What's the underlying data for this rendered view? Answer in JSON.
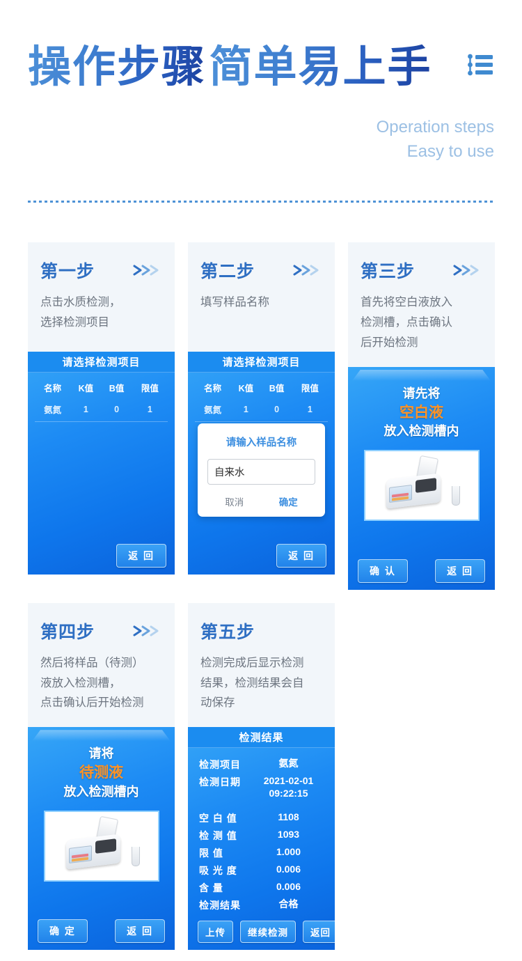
{
  "header": {
    "title_line1": "操作步骤",
    "title_line2": "简单易上手",
    "en_line1": "Operation steps",
    "en_line2": "Easy to use",
    "icon": "list-icon"
  },
  "colors": {
    "accent_blue": "#2f6fc3",
    "screen_blue": "#1b8cf0",
    "orange": "#ff9326",
    "card_bg": "#f2f6fa",
    "muted_text": "#6d7580",
    "en_text": "#9cc0e4"
  },
  "cards": [
    {
      "step": "第一步",
      "chevron": "chevrons-right-icon",
      "desc_lines": [
        "点击水质检测，",
        "选择检测项目"
      ],
      "screen": {
        "type": "table",
        "bar_title": "请选择检测项目",
        "table": {
          "headers": [
            "名称",
            "K值",
            "B值",
            "限值"
          ],
          "rows": [
            [
              "氨氮",
              "1",
              "0",
              "1"
            ]
          ]
        },
        "buttons": [
          "返 回"
        ]
      }
    },
    {
      "step": "第二步",
      "chevron": "chevrons-right-icon",
      "desc_lines": [
        "填写样品名称"
      ],
      "screen": {
        "type": "table-dialog",
        "bar_title": "请选择检测项目",
        "table": {
          "headers": [
            "名称",
            "K值",
            "B值",
            "限值"
          ],
          "rows": [
            [
              "氨氮",
              "1",
              "0",
              "1"
            ]
          ]
        },
        "dialog": {
          "title": "请输入样品名称",
          "input_value": "自来水",
          "input_placeholder": "请输入样品名称",
          "cancel": "取消",
          "confirm": "确定"
        },
        "buttons": [
          "返 回"
        ]
      }
    },
    {
      "step": "第三步",
      "chevron": "chevrons-right-icon",
      "desc_lines": [
        "首先将空白液放入",
        "检测槽，点击确认",
        "后开始检测"
      ],
      "screen": {
        "type": "instruction",
        "line1": "请先将",
        "line2": "空白液",
        "line3": "放入检测槽内",
        "photo": "photometer-device-photo",
        "buttons": [
          "确 认",
          "返 回"
        ]
      }
    },
    {
      "step": "第四步",
      "chevron": "chevrons-right-icon",
      "desc_lines": [
        "然后将样品（待测）",
        "液放入检测槽，",
        "点击确认后开始检测"
      ],
      "screen": {
        "type": "instruction",
        "line1": "请将",
        "line2": "待测液",
        "line3": "放入检测槽内",
        "photo": "photometer-device-photo",
        "buttons": [
          "确 定",
          "返 回"
        ]
      }
    },
    {
      "step": "第五步",
      "chevron": "",
      "desc_lines": [
        "检测完成后显示检测",
        "结果，检测结果会自",
        "动保存"
      ],
      "screen": {
        "type": "result",
        "bar_title": "检测结果",
        "rows": [
          {
            "key": "检测项目",
            "value": "氨氮"
          },
          {
            "key": "检测日期",
            "value": "2021-02-01",
            "value2": "09:22:15"
          },
          {
            "key": "空 白 值",
            "value": "1108"
          },
          {
            "key": "检 测 值",
            "value": "1093"
          },
          {
            "key": "限    值",
            "value": "1.000"
          },
          {
            "key": "吸 光 度",
            "value": "0.006"
          },
          {
            "key": "含    量",
            "value": "0.006"
          },
          {
            "key": "检测结果",
            "value": "合格"
          }
        ],
        "buttons": [
          "上传",
          "继续检测",
          "返回"
        ]
      }
    }
  ]
}
